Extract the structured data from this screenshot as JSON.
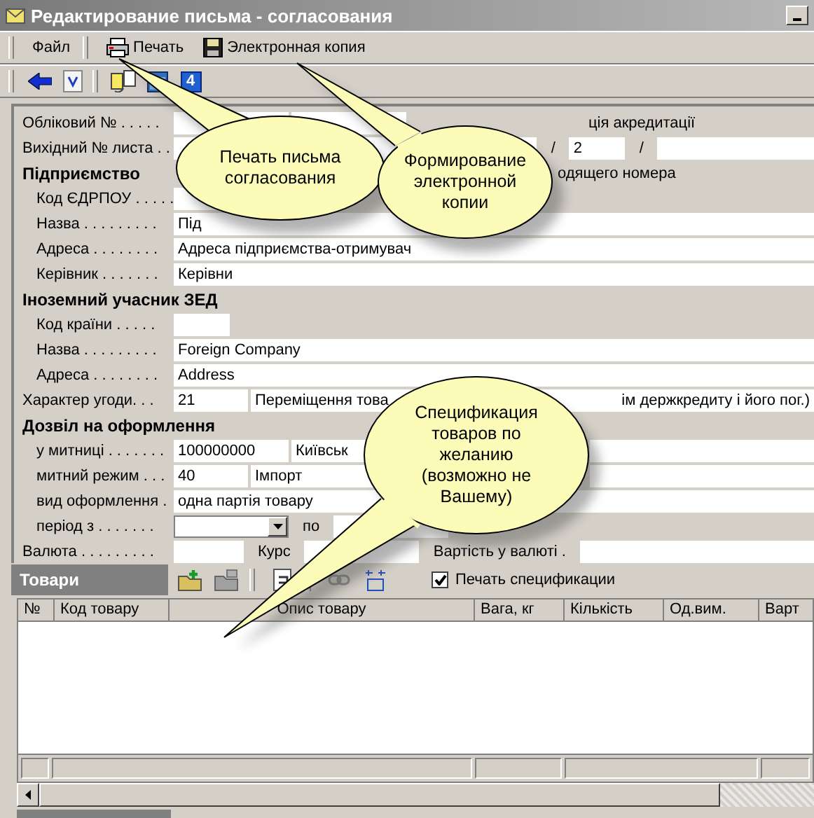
{
  "window": {
    "title": "Редактирование письма - согласования"
  },
  "menu": [
    {
      "kind": "plain",
      "label": "Файл"
    },
    {
      "kind": "print",
      "label": "Печать"
    },
    {
      "kind": "save",
      "label": "Электронная копия"
    }
  ],
  "toolbar": {
    "badge": "4"
  },
  "form": [
    {
      "kind": "field",
      "label": "Обліковий № . . . . .",
      "cells": [
        {
          "kind": "medium"
        },
        {
          "kind": "medium"
        },
        {
          "kind": "fartext",
          "value": "ція акредитації"
        }
      ]
    },
    {
      "kind": "field",
      "label": "Вихідний № листа . .",
      "cells": [
        {
          "kind": "wide"
        },
        {
          "kind": "text",
          "value": "/"
        },
        {
          "kind": "tiny",
          "value": "2"
        },
        {
          "kind": "text",
          "value": "/"
        },
        {
          "kind": "flex"
        }
      ]
    },
    {
      "kind": "section",
      "label": "Підприємство",
      "note": "одящего номера",
      "children": [
        {
          "kind": "field",
          "label": "Код ЄДРПОУ . . . . .",
          "cells": [
            {
              "kind": "medium"
            }
          ]
        },
        {
          "kind": "field",
          "label": "Назва . . . . . . . . .",
          "cells": [
            {
              "kind": "flex",
              "value": "Під"
            }
          ]
        },
        {
          "kind": "field",
          "label": "Адреса . . . . . . . .",
          "cells": [
            {
              "kind": "flex",
              "value": "Адреса підприємства-отримувач"
            }
          ]
        },
        {
          "kind": "field",
          "label": "Керівник . . . . . . .",
          "cells": [
            {
              "kind": "flex",
              "value": "Керівни"
            }
          ]
        }
      ]
    },
    {
      "kind": "section",
      "label": "Іноземний учасник ЗЕД",
      "children": [
        {
          "kind": "field",
          "label": "Код країни . . . . .",
          "cells": [
            {
              "kind": "tiny"
            }
          ]
        },
        {
          "kind": "field",
          "label": "Назва . . . . . . . . .",
          "cells": [
            {
              "kind": "flex",
              "value": "Foreign Company"
            }
          ]
        },
        {
          "kind": "field",
          "label": "Адреса . . . . . . . .",
          "cells": [
            {
              "kind": "flex",
              "value": "Address"
            }
          ]
        }
      ]
    },
    {
      "kind": "field",
      "label": "Характер угоди. . .",
      "cells": [
        {
          "kind": "short",
          "value": "21"
        },
        {
          "kind": "flex",
          "value": "Переміщення това"
        },
        {
          "kind": "rflex",
          "value": "ім держкредиту і його пог.)"
        }
      ]
    },
    {
      "kind": "section",
      "label": "Дозвіл на оформлення",
      "children": [
        {
          "kind": "field",
          "label": "у митниці . . . . . . .",
          "cells": [
            {
              "kind": "medium",
              "value": "100000000"
            },
            {
              "kind": "cut",
              "value": "Київськ"
            },
            {
              "kind": "rest"
            }
          ]
        },
        {
          "kind": "field",
          "label": "митний режим . . .",
          "cells": [
            {
              "kind": "short",
              "value": "40"
            },
            {
              "kind": "cut",
              "value": "Імпорт"
            },
            {
              "kind": "rest"
            }
          ]
        },
        {
          "kind": "field",
          "label": "вид оформлення .",
          "cells": [
            {
              "kind": "flex",
              "value": "одна партія товару"
            }
          ]
        },
        {
          "kind": "field",
          "label": "період з . . . . . . .",
          "cells": [
            {
              "kind": "combo"
            },
            {
              "kind": "text",
              "value": "по"
            },
            {
              "kind": "medium"
            }
          ]
        }
      ]
    },
    {
      "kind": "field",
      "label": "Валюта . . . . . . . . .",
      "cells": [
        {
          "kind": "small"
        },
        {
          "kind": "text",
          "value": "Курс"
        },
        {
          "kind": "medium"
        },
        {
          "kind": "text",
          "value": "Вартість у валюті ."
        },
        {
          "kind": "flex"
        }
      ]
    }
  ],
  "grid": {
    "title": "Товари",
    "print_spec": {
      "label": "Печать спецификации",
      "checked": true
    },
    "columns": [
      "№",
      "Код товару",
      "Опис товару",
      "Вага, кг",
      "Кількість",
      "Од.вим.",
      "Варт"
    ]
  },
  "callouts": [
    {
      "text": "Печать письма согласования"
    },
    {
      "text": "Формирование электронной копии"
    },
    {
      "text": "Спецификация товаров по желанию (возможно не Вашему)"
    }
  ]
}
